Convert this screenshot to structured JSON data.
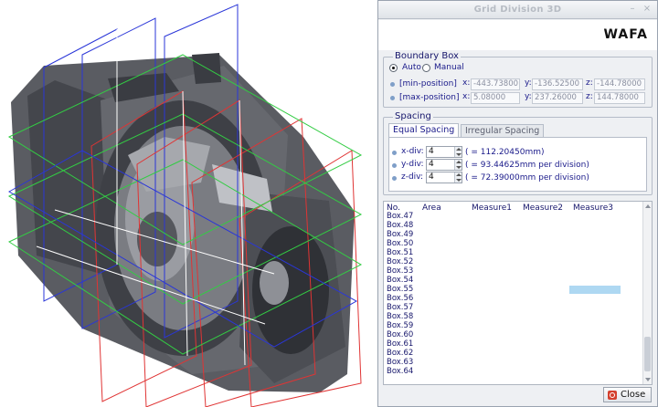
{
  "window": {
    "title": "Grid Division 3D",
    "minimize_glyph": "–",
    "close_glyph": "×"
  },
  "logo": {
    "text": "WAFA"
  },
  "boundary_box": {
    "label": "Boundary Box",
    "mode_auto": "Auto",
    "mode_manual": "Manual",
    "selected_mode": "Auto",
    "min": {
      "label": "[min-position]",
      "x": "-443.73800",
      "y": "-136.52500",
      "z": "-144.78000"
    },
    "max": {
      "label": "[max-position]",
      "x": "5.08000",
      "y": "237.26000",
      "z": "144.78000"
    },
    "axis_x": "x:",
    "axis_y": "y:",
    "axis_z": "z:"
  },
  "spacing": {
    "label": "Spacing",
    "tabs": [
      "Equal Spacing",
      "Irregular Spacing"
    ],
    "active_tab": "Equal Spacing",
    "x_div": {
      "label": "x-div:",
      "value": "4",
      "result": "( = 112.20450mm)"
    },
    "y_div": {
      "label": "y-div:",
      "value": "4",
      "result": "( = 93.44625mm per division)"
    },
    "z_div": {
      "label": "z-div:",
      "value": "4",
      "result": "( = 72.39000mm per division)"
    }
  },
  "table": {
    "columns": [
      "No.",
      "Area",
      "Measure1",
      "Measure2",
      "Measure3"
    ],
    "rows": [
      "Box.47",
      "Box.48",
      "Box.49",
      "Box.50",
      "Box.51",
      "Box.52",
      "Box.53",
      "Box.54",
      "Box.55",
      "Box.56",
      "Box.57",
      "Box.58",
      "Box.59",
      "Box.60",
      "Box.61",
      "Box.62",
      "Box.63",
      "Box.64"
    ],
    "highlighted_row": "Box.55",
    "highlight_color": "#aed8f2"
  },
  "close_button": {
    "label": "Close",
    "icon": "close-icon"
  },
  "viewport": {
    "model": "gearbox-housing-cad",
    "colors": {
      "body": "#4a4c52",
      "grid_red": "#e03434",
      "grid_blue": "#2a36d8",
      "grid_green": "#33cc44"
    }
  }
}
